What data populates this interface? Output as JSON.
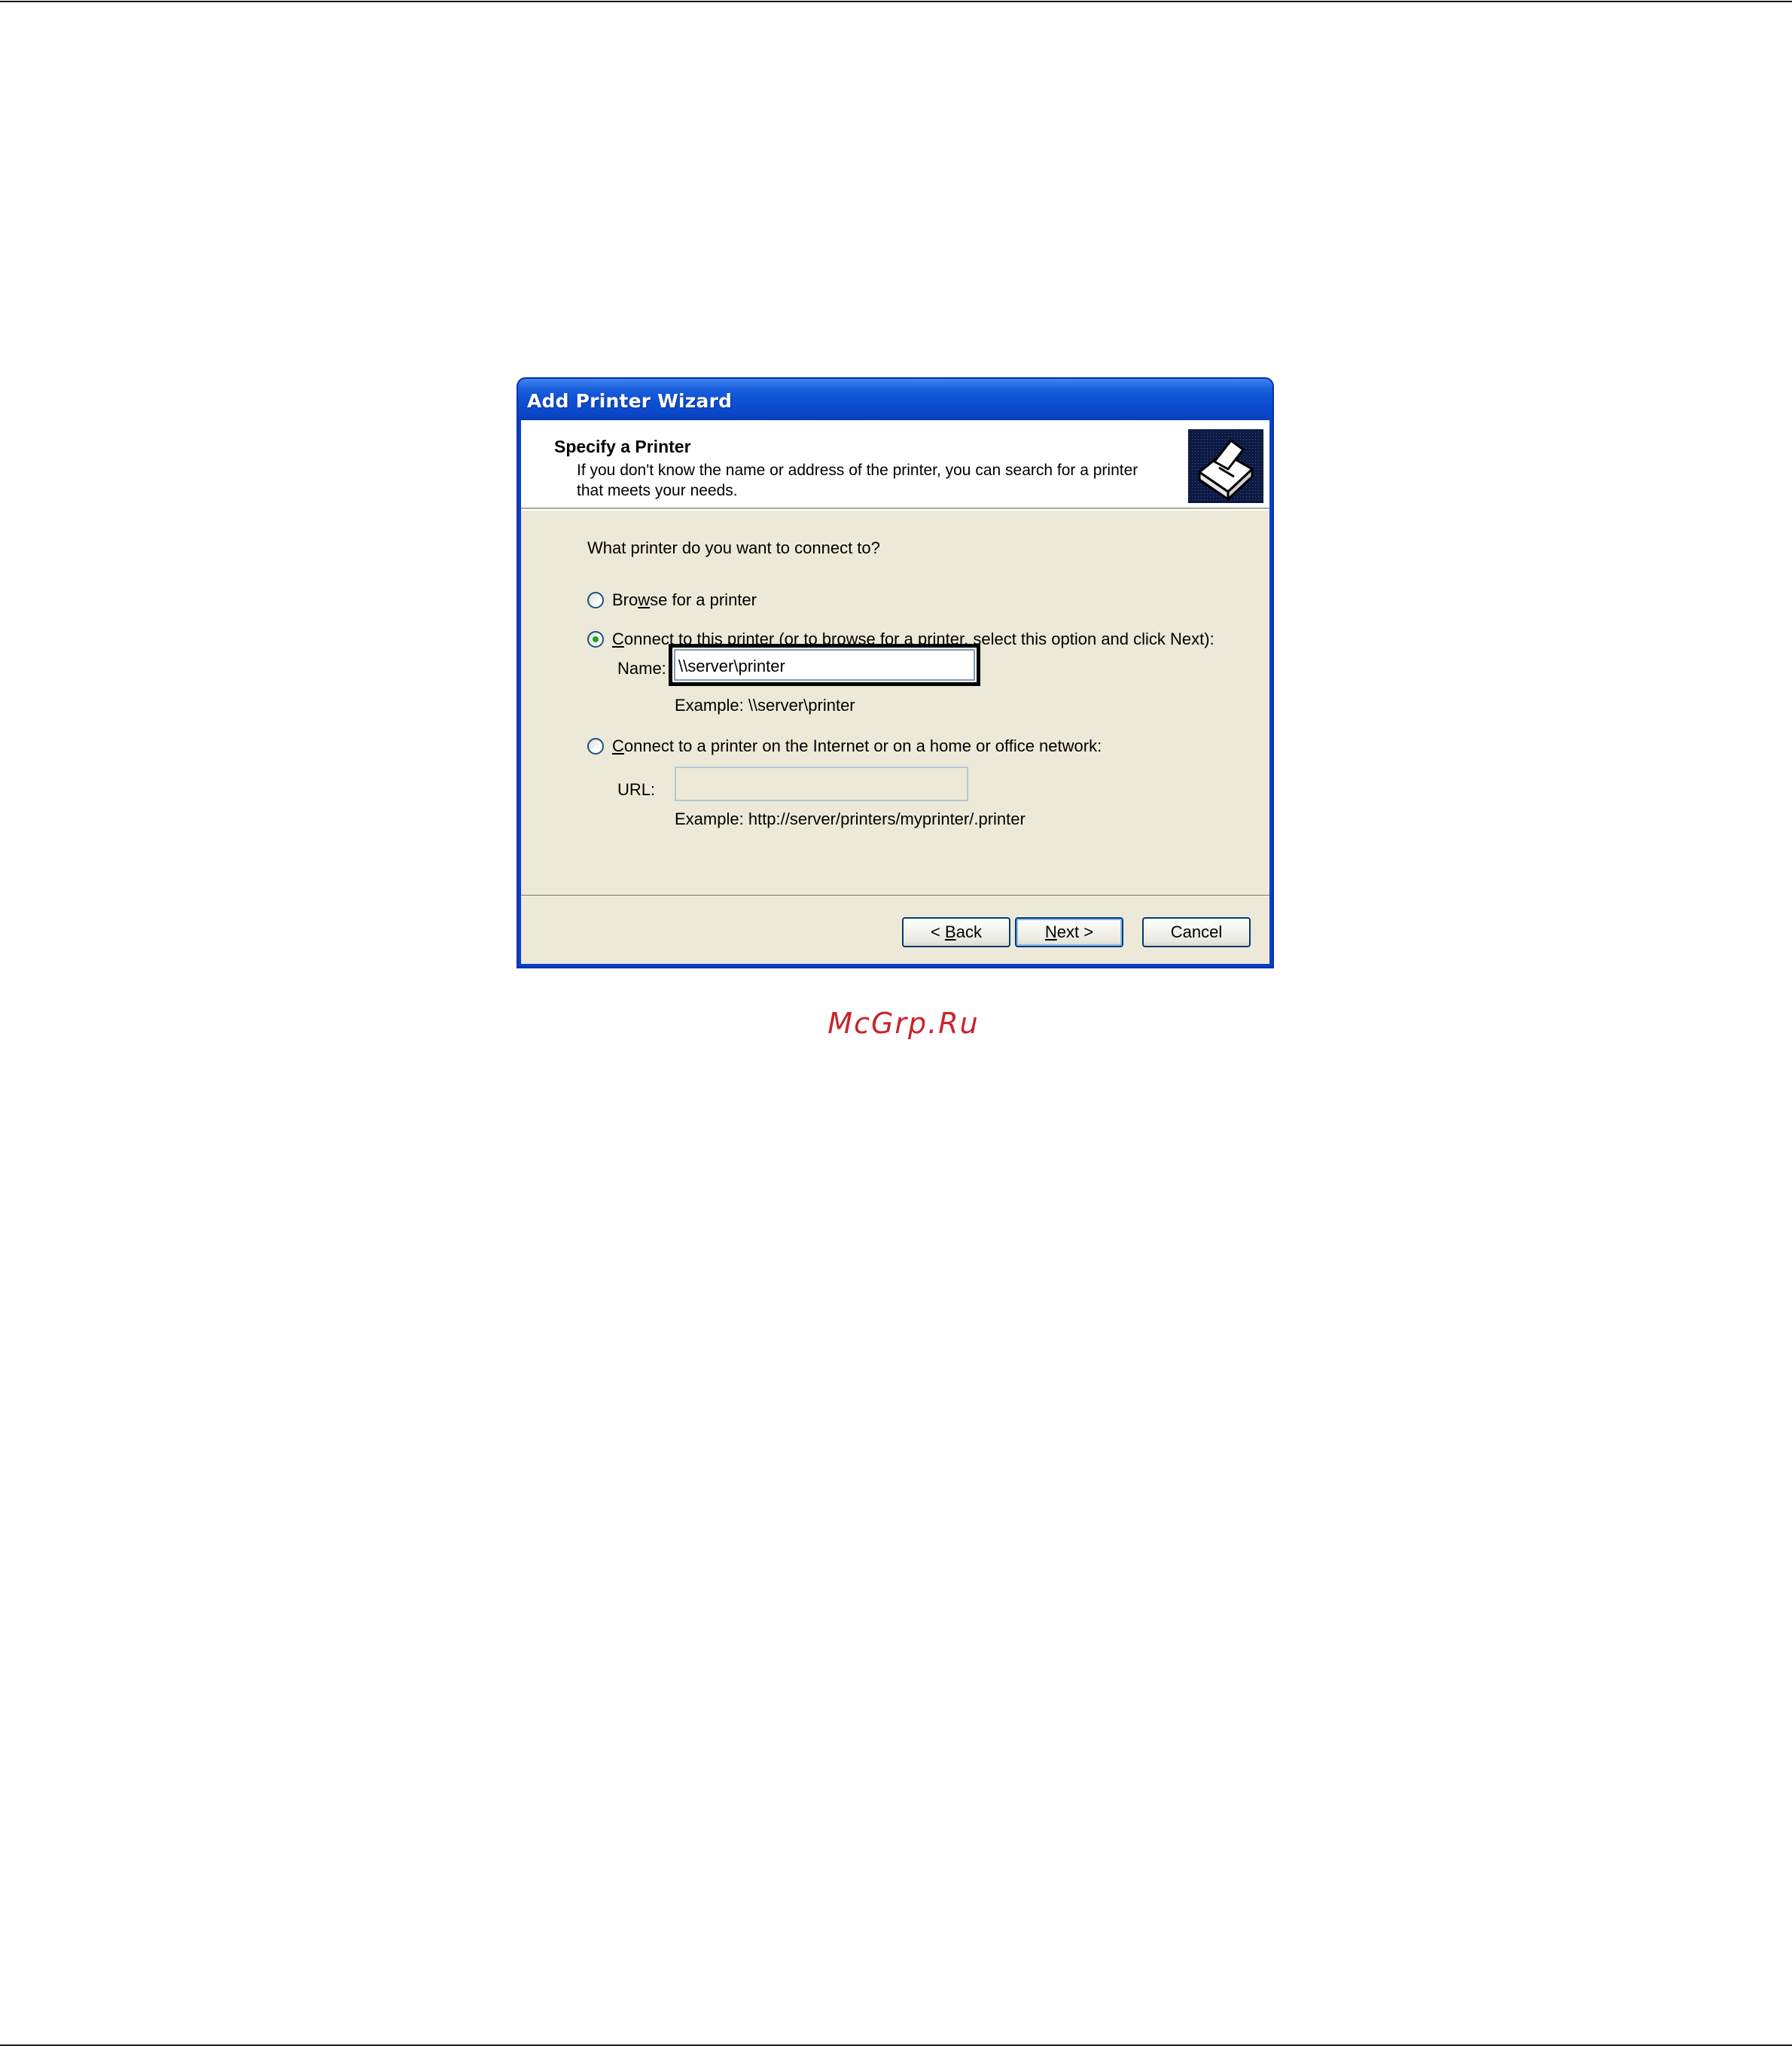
{
  "window": {
    "title": "Add Printer Wizard"
  },
  "header": {
    "title": "Specify a Printer",
    "subtitle_line1": "If you don't know the name or address of the printer, you can search for a printer",
    "subtitle_line2": "that meets your needs.",
    "icon": "printer-wizard-icon"
  },
  "content": {
    "question": "What printer do you want to connect to?",
    "options": [
      {
        "label_accel": "Bro",
        "label_key": "w",
        "label_rest": "se for a printer",
        "selected": false
      },
      {
        "label_accel": "",
        "label_key": "C",
        "label_rest": "onnect to this printer (or to browse for a printer, select this option and click Next):",
        "selected": true
      },
      {
        "label_accel": "",
        "label_key": "C",
        "label_rest": "onnect to a printer on the Internet or on a home or office network:",
        "selected": false
      }
    ],
    "name_label": "Name:",
    "name_value": "\\\\server\\printer",
    "name_example": "Example: \\\\server\\printer",
    "url_label": "URL:",
    "url_value": "",
    "url_example": "Example: http://server/printers/myprinter/.printer"
  },
  "buttons": {
    "back_prefix": "< ",
    "back_key": "B",
    "back_rest": "ack",
    "next_key": "N",
    "next_rest": "ext >",
    "cancel": "Cancel"
  },
  "watermark": "McGrp.Ru",
  "colors": {
    "titlebar": "#0a46c7",
    "dialog_face": "#ece9d8",
    "button_border": "#003c74",
    "watermark": "#c8242c",
    "radio_dot": "#21a121"
  }
}
